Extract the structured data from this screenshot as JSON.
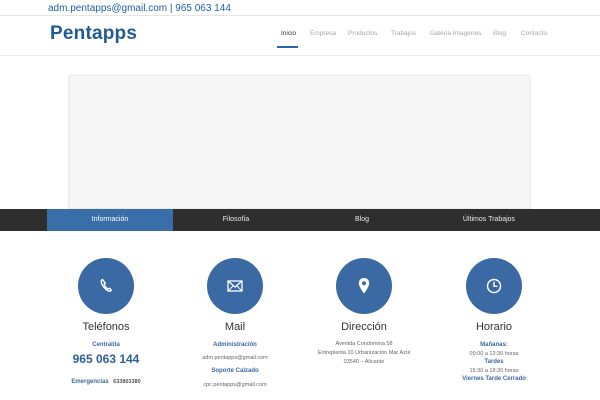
{
  "topbar": {
    "email": "adm.pentapps@gmail.com",
    "separator": "|",
    "phone": "965 063 144"
  },
  "header": {
    "logo": "Pentapps"
  },
  "nav": {
    "items": [
      {
        "label": "Inicio",
        "active": true
      },
      {
        "label": "Empresa",
        "active": false
      },
      {
        "label": "Productos",
        "active": false
      },
      {
        "label": "Trabajos",
        "active": false
      },
      {
        "label": "Galeria Imagenes",
        "active": false
      },
      {
        "label": "Blog",
        "active": false
      },
      {
        "label": "Contacto",
        "active": false
      }
    ]
  },
  "tabs": [
    {
      "label": "Información",
      "active": true
    },
    {
      "label": "Filosofía",
      "active": false
    },
    {
      "label": "Blog",
      "active": false
    },
    {
      "label": "Últimos Trabajos",
      "active": false
    }
  ],
  "columns": {
    "telefonos": {
      "icon": "phone-icon",
      "title": "Teléfonos",
      "centralita_label": "Centralita",
      "centralita_phone": "965 063 144",
      "emergencias_label": "Emergencias",
      "emergencias_phone": "633803380"
    },
    "mail": {
      "icon": "mail-icon",
      "title": "Mail",
      "admin_label": "Administración",
      "admin_email": "adm.pentapps@gmail.com",
      "soporte_label": "Soporte Calzado",
      "soporte_email": "cpc.pentapps@gmail.com"
    },
    "direccion": {
      "icon": "location-pin-icon",
      "title": "Dirección",
      "line1": "Avenida Condomina 58",
      "line2": "Entreplanta 10 Urbanización Mar Azul",
      "line3": "03540 – Alicante"
    },
    "horario": {
      "icon": "clock-icon",
      "title": "Horario",
      "mananas_label": "Mañanas:",
      "mananas_hours": "09:00 a 13:30 horas",
      "tardes_label": "Tardes",
      "tardes_hours": "15:30 a 18:30 horas",
      "viernes_label": "Viernes Tarde Cerrado"
    }
  },
  "colors": {
    "accent": "#3a69a3",
    "logo": "#1f5b95",
    "tabbar": "#2e2e2e"
  }
}
